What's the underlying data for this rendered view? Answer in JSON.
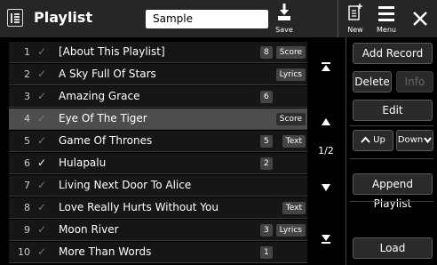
{
  "header": {
    "title": "Playlist",
    "playlist_name": "Sample",
    "save_label": "Save",
    "new_label": "New",
    "menu_label": "Menu"
  },
  "rows": [
    {
      "num": "1",
      "checked": false,
      "text": "[About This Playlist]",
      "count": "8",
      "tag": "Score",
      "selected": false
    },
    {
      "num": "2",
      "checked": false,
      "text": "A Sky Full Of Stars",
      "count": "",
      "tag": "Lyrics",
      "selected": false
    },
    {
      "num": "3",
      "checked": false,
      "text": "Amazing Grace",
      "count": "6",
      "tag": "",
      "selected": false
    },
    {
      "num": "4",
      "checked": false,
      "text": "Eye Of The Tiger",
      "count": "",
      "tag": "Score",
      "selected": true
    },
    {
      "num": "5",
      "checked": false,
      "text": "Game Of Thrones",
      "count": "5",
      "tag": "Text",
      "selected": false
    },
    {
      "num": "6",
      "checked": true,
      "text": "Hulapalu",
      "count": "2",
      "tag": "",
      "selected": false
    },
    {
      "num": "7",
      "checked": false,
      "text": "Living Next Door To Alice",
      "count": "",
      "tag": "",
      "selected": false
    },
    {
      "num": "8",
      "checked": false,
      "text": "Love Really Hurts Without You",
      "count": "",
      "tag": "Text",
      "selected": false
    },
    {
      "num": "9",
      "checked": false,
      "text": "Moon River",
      "count": "3",
      "tag": "Lyrics",
      "selected": false
    },
    {
      "num": "10",
      "checked": false,
      "text": "More Than Words",
      "count": "1",
      "tag": "",
      "selected": false
    }
  ],
  "pager": {
    "page_text": "1/2"
  },
  "panel": {
    "add_record": "Add Record",
    "delete": "Delete",
    "info": "Info",
    "edit": "Edit",
    "up": "Up",
    "down": "Down",
    "append_playlist": "Append Playlist",
    "load": "Load"
  },
  "icons": {
    "checkmark": "✓",
    "top": "top-arrow-icon",
    "up": "up-arrow-icon",
    "down": "down-arrow-icon",
    "bottom": "bottom-arrow-icon"
  }
}
